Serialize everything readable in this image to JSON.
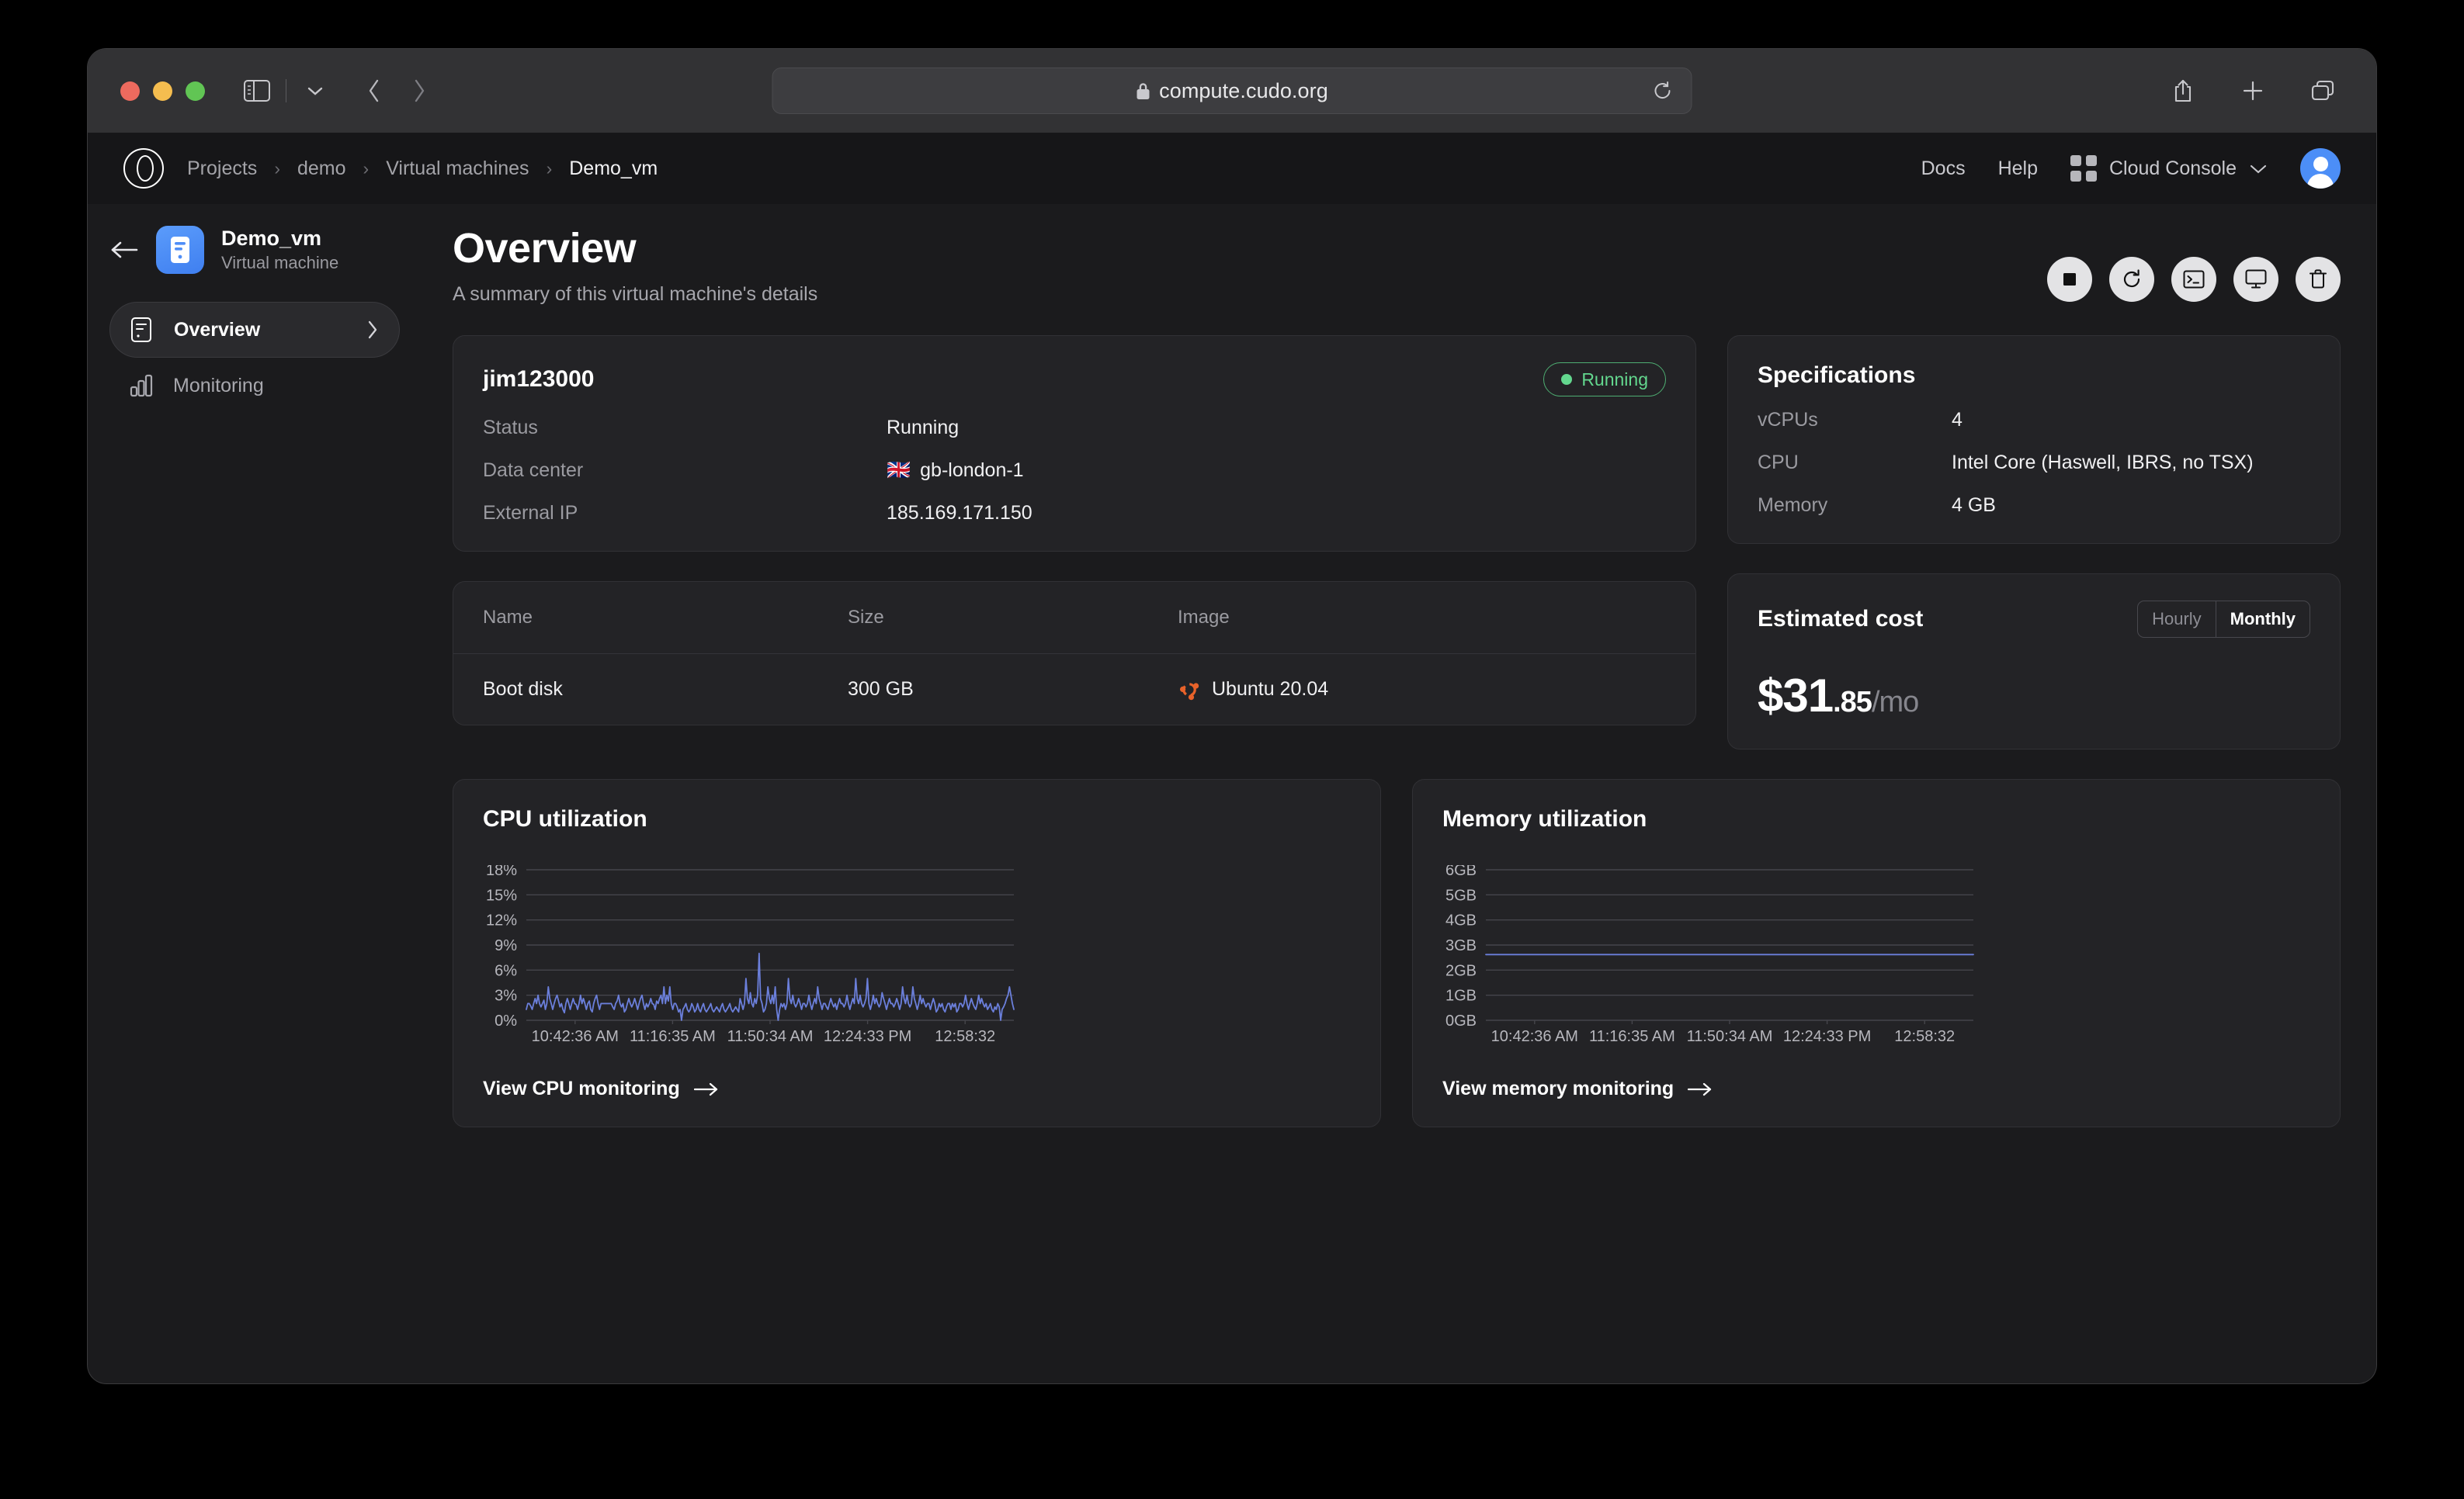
{
  "browser": {
    "url": "compute.cudo.org",
    "lock_icon": "lock-icon",
    "reload_icon": "reload-icon",
    "sidebar_toggle_icon": "sidebar-toggle-icon",
    "tab_overview_icon": "tab-overview-icon",
    "back_icon": "back-icon",
    "forward_icon": "forward-icon",
    "share_icon": "share-icon",
    "new_tab_icon": "plus-icon",
    "tabs_icon": "tabs-icon"
  },
  "topnav": {
    "logo_icon": "cudo-logo-icon",
    "breadcrumbs": [
      {
        "label": "Projects",
        "current": false
      },
      {
        "label": "demo",
        "current": false
      },
      {
        "label": "Virtual machines",
        "current": false
      },
      {
        "label": "Demo_vm",
        "current": true
      }
    ],
    "separator": "›",
    "links": [
      "Docs",
      "Help"
    ],
    "console_label": "Cloud Console",
    "console_caret": "chevron-down-icon",
    "apps_icon": "apps-grid-icon",
    "avatar": "user-avatar"
  },
  "sidebar": {
    "back_icon": "arrow-left-icon",
    "vm_icon": "virtual-machine-icon",
    "vm_name": "Demo_vm",
    "vm_type": "Virtual machine",
    "items": [
      {
        "label": "Overview",
        "icon": "server-icon",
        "active": true,
        "chevron": "chevron-right-icon"
      },
      {
        "label": "Monitoring",
        "icon": "bar-chart-icon",
        "active": false,
        "chevron": ""
      }
    ]
  },
  "page": {
    "title": "Overview",
    "subtitle": "A summary of this virtual machine's details",
    "actions": [
      {
        "name": "stop-button",
        "icon": "stop-icon"
      },
      {
        "name": "restart-button",
        "icon": "restart-icon"
      },
      {
        "name": "terminal-button",
        "icon": "terminal-icon"
      },
      {
        "name": "console-button",
        "icon": "monitor-icon"
      },
      {
        "name": "delete-button",
        "icon": "trash-icon"
      }
    ]
  },
  "details": {
    "hostname": "jim123000",
    "status_badge": "Running",
    "status_color": "#63d78e",
    "rows": [
      {
        "key": "Status",
        "value": "Running",
        "flag": ""
      },
      {
        "key": "Data center",
        "value": "gb-london-1",
        "flag": "🇬🇧"
      },
      {
        "key": "External IP",
        "value": "185.169.171.150",
        "flag": ""
      }
    ]
  },
  "disks": {
    "columns": [
      "Name",
      "Size",
      "Image"
    ],
    "rows": [
      {
        "name": "Boot disk",
        "size": "300 GB",
        "image": "Ubuntu 20.04",
        "image_icon": "ubuntu-logo-icon"
      }
    ]
  },
  "specifications": {
    "title": "Specifications",
    "rows": [
      {
        "key": "vCPUs",
        "value": "4"
      },
      {
        "key": "CPU",
        "value": "Intel Core (Haswell, IBRS, no TSX)"
      },
      {
        "key": "Memory",
        "value": "4 GB"
      }
    ]
  },
  "cost": {
    "title": "Estimated cost",
    "options": [
      {
        "label": "Hourly",
        "selected": false
      },
      {
        "label": "Monthly",
        "selected": true
      }
    ],
    "amount_whole": "$31",
    "amount_cents": ".85",
    "amount_period": "/mo"
  },
  "chart_data": [
    {
      "type": "line",
      "name": "cpu",
      "title": "CPU utilization",
      "link_label": "View CPU monitoring",
      "link_icon": "arrow-right-icon",
      "xlabel": "",
      "ylabel": "",
      "ylim": [
        0,
        18
      ],
      "grid": true,
      "line_color": "#6b7fdb",
      "ytick_labels": [
        "0%",
        "3%",
        "6%",
        "9%",
        "12%",
        "15%",
        "18%"
      ],
      "ytick_values": [
        0,
        3,
        6,
        9,
        12,
        15,
        18
      ],
      "xtick_labels": [
        "10:42:36 AM",
        "11:16:35 AM",
        "11:50:34 AM",
        "12:24:33 PM",
        "12:58:32"
      ],
      "values": [
        1.3,
        2,
        2,
        1.7,
        1.3,
        2,
        2.6,
        2,
        3,
        2,
        1.6,
        2,
        2.4,
        1.3,
        2,
        4,
        2.6,
        2,
        1.3,
        2,
        2.6,
        3,
        2.3,
        1.6,
        2,
        1.3,
        0.9,
        2,
        2.6,
        2,
        1.3,
        2,
        2.6,
        2,
        1.9,
        1.3,
        2,
        3,
        2,
        2.6,
        2,
        1.3,
        2,
        2.3,
        1.3,
        1,
        2,
        2.6,
        3,
        2,
        1.3,
        2,
        2,
        2,
        2,
        2,
        2,
        2,
        2,
        1.6,
        1.3,
        2,
        2.3,
        3,
        2,
        1.6,
        2,
        1,
        1.3,
        2,
        2.6,
        2,
        1.6,
        2,
        2.6,
        2,
        1.3,
        2,
        2.6,
        3,
        2,
        1.3,
        2,
        1.6,
        2,
        2.6,
        2,
        1.9,
        1.3,
        2.3,
        2,
        2.6,
        3,
        2,
        4,
        2,
        3,
        2.3,
        4,
        2,
        1.3,
        2,
        2,
        1.6,
        1,
        1.3,
        0,
        1.3,
        1.6,
        2,
        1.3,
        1,
        1.3,
        2,
        1.6,
        1,
        1.3,
        2,
        1.3,
        1,
        1.6,
        2,
        1.3,
        1,
        1.3,
        1.6,
        2,
        1.3,
        1,
        1.3,
        1.6,
        1.3,
        1,
        1.6,
        2,
        1.3,
        1,
        1.3,
        1.6,
        2,
        1.3,
        1,
        1.3,
        1.6,
        1.3,
        1,
        2.6,
        2,
        1.3,
        2,
        5,
        2.6,
        2,
        3.3,
        2,
        1.6,
        2.6,
        2,
        3,
        8,
        2.6,
        2,
        1,
        1.3,
        2,
        4,
        2.6,
        2,
        3,
        2,
        4,
        1.3,
        0,
        1.3,
        2,
        1.6,
        2,
        1.3,
        2,
        5,
        2.6,
        2,
        3,
        2,
        1.6,
        2,
        2.6,
        2,
        1.3,
        2,
        2,
        1.6,
        2,
        3,
        2,
        1.3,
        2,
        2.6,
        2,
        4,
        2.6,
        2,
        1.3,
        2,
        2,
        1.6,
        1.3,
        2,
        2.6,
        2,
        1.6,
        2,
        1.3,
        2,
        2.6,
        2,
        2,
        1.6,
        2,
        3,
        2,
        1.3,
        2,
        2.6,
        2,
        5,
        2.6,
        2,
        3,
        2,
        1.6,
        2,
        2.6,
        5,
        2,
        1.3,
        2,
        3,
        2,
        2.6,
        2,
        1.6,
        2,
        3.3,
        2.6,
        2,
        1.3,
        2,
        2.6,
        2,
        2,
        1.6,
        2,
        2.6,
        2,
        1.3,
        2,
        4,
        2.6,
        2,
        3,
        2,
        1.6,
        2,
        4,
        2.6,
        2,
        1.3,
        2,
        3,
        2,
        2.6,
        2,
        1.6,
        2,
        2,
        1.3,
        2,
        2.6,
        2,
        1,
        1.3,
        2,
        1.6,
        2,
        1.3,
        1,
        1.6,
        2,
        2,
        1.3,
        2,
        1.6,
        2,
        1,
        1.3,
        2,
        2,
        1.6,
        2,
        3,
        2,
        1.3,
        2,
        2.6,
        2,
        1.6,
        1.3,
        2,
        3,
        2,
        2.6,
        2,
        1.6,
        2,
        1.3,
        1.6,
        2,
        1.3,
        1,
        1.6,
        1.3,
        2,
        1.6,
        0,
        1.3,
        1.6,
        2,
        2.6,
        3,
        4,
        3,
        2,
        1.3
      ]
    },
    {
      "type": "line",
      "name": "memory",
      "title": "Memory utilization",
      "link_label": "View memory monitoring",
      "link_icon": "arrow-right-icon",
      "xlabel": "",
      "ylabel": "",
      "ylim": [
        0,
        6
      ],
      "grid": true,
      "line_color": "#6b7fdb",
      "ytick_labels": [
        "0GB",
        "1GB",
        "2GB",
        "3GB",
        "4GB",
        "5GB",
        "6GB"
      ],
      "ytick_values": [
        0,
        1,
        2,
        3,
        4,
        5,
        6
      ],
      "xtick_labels": [
        "10:42:36 AM",
        "11:16:35 AM",
        "11:50:34 AM",
        "12:24:33 PM",
        "12:58:32"
      ],
      "constant_value": 2.62
    }
  ]
}
